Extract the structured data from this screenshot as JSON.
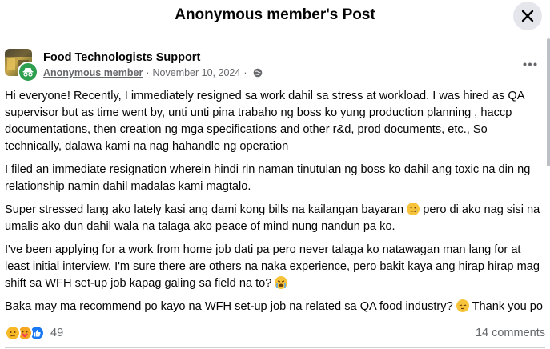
{
  "header": {
    "title": "Anonymous member's Post",
    "close_icon": "close-icon"
  },
  "post": {
    "group_name": "Food Technologists Support",
    "author": "Anonymous member",
    "separator": "·",
    "date": "November 10, 2024",
    "privacy_icon": "globe-icon",
    "more_icon": "more-options-icon",
    "paragraphs": [
      "Hi everyone! Recently, I immediately resigned sa work dahil sa stress at workload. I was hired as QA supervisor  but as time went by, unti unti pina trabaho ng boss ko yung production planning , haccp documentations, then creation ng mga specifications and other r&d,  prod documents, etc., So technically, dalawa kami na nag hahandle ng operation",
      "I filed an immediate resignation wherein hindi rin naman tinutulan ng boss ko dahil ang toxic na din ng relationship namin dahil madalas kami magtalo.",
      "Super stressed lang ako lately kasi ang dami kong bills na kailangan bayaran",
      "pero di ako nag sisi na umalis ako dun dahil wala na talaga ako peace of mind nung nandun pa ko.",
      "I've been applying for a work from home job dati pa pero never talaga ko natawagan man lang for at least initial interview. I'm sure there are others na naka experience, pero bakit kaya ang hirap hirap mag shift sa WFH set-up job kapag galing sa field na to?",
      "Baka may ma recommend po kayo na WFH set-up job na related sa QA food industry?",
      "Thank you po"
    ],
    "reaction_count": "49",
    "comments_count": "14 comments"
  },
  "colors": {
    "badge_green": "#2e9e4f",
    "like_blue": "#1877f2",
    "muted_text": "#65676b"
  }
}
